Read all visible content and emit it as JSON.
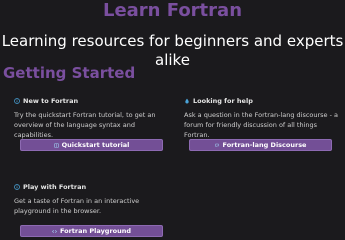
{
  "hero": {
    "title": "Learn Fortran",
    "subtitle": "Learning resources for beginners and experts alike"
  },
  "section": {
    "heading": "Getting Started"
  },
  "cards": [
    {
      "title": "New to Fortran",
      "icon": "info-icon",
      "description": "Try the quickstart Fortran tutorial, to get an overview of the language syntax and capabilities.",
      "button_label": "Quickstart tutorial",
      "button_icon": "book-icon"
    },
    {
      "title": "Looking for help",
      "icon": "question-icon",
      "description": "Ask a question in the Fortran-lang discourse - a forum for friendly discussion of all things Fortran.",
      "button_label": "Fortran-lang Discourse",
      "button_icon": "comments-icon"
    },
    {
      "title": "Play with Fortran",
      "icon": "info-icon",
      "description": "Get a taste of Fortran in an interactive playground in the browser.",
      "button_label": "Fortran Playground",
      "button_icon": "code-icon"
    }
  ],
  "colors": {
    "background": "#1b1a1d",
    "accent": "#7a4f9f",
    "button": "#734f96",
    "icon": "#4aa3d8"
  }
}
